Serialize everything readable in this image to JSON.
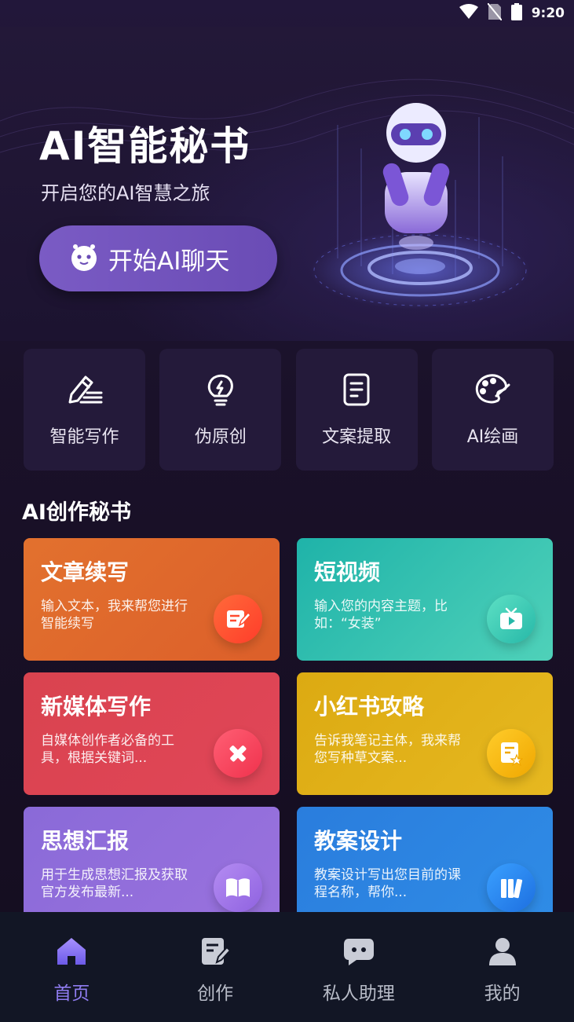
{
  "status_bar": {
    "time": "9:20"
  },
  "hero": {
    "title": "AI智能秘书",
    "subtitle": "开启您的AI智慧之旅",
    "start_button": "开始AI聊天"
  },
  "tools": [
    {
      "label": "智能写作",
      "icon": "pen-write-icon"
    },
    {
      "label": "伪原创",
      "icon": "lightbulb-icon"
    },
    {
      "label": "文案提取",
      "icon": "document-icon"
    },
    {
      "label": "AI绘画",
      "icon": "palette-icon"
    }
  ],
  "section_title": "AI创作秘书",
  "cards": [
    {
      "title": "文章续写",
      "desc": "输入文本，我来帮您进行智能续写",
      "icon": "edit-note-icon"
    },
    {
      "title": "短视频",
      "desc": "输入您的内容主题，比如：“女装”",
      "icon": "tv-play-icon"
    },
    {
      "title": "新媒体写作",
      "desc": "自媒体创作者必备的工具，根据关键词...",
      "icon": "pencil-ruler-icon"
    },
    {
      "title": "小红书攻略",
      "desc": "告诉我笔记主体，我来帮您写种草文案...",
      "icon": "note-star-icon"
    },
    {
      "title": "思想汇报",
      "desc": "用于生成思想汇报及获取官方发布最新...",
      "icon": "book-open-icon"
    },
    {
      "title": "教案设计",
      "desc": "教案设计写出您目前的课程名称，帮你...",
      "icon": "books-icon"
    }
  ],
  "colors": {
    "card_1": "#e26a2c",
    "card_2": "#3cc6b6",
    "card_3": "#dc4053",
    "card_4": "#e0b21c",
    "card_5": "#8a6ad8",
    "card_6": "#2d86e2",
    "active_nav": "#8f7cf0"
  },
  "nav": [
    {
      "label": "首页",
      "icon": "home-icon",
      "active": true
    },
    {
      "label": "创作",
      "icon": "create-icon"
    },
    {
      "label": "私人助理",
      "icon": "chat-bubble-icon"
    },
    {
      "label": "我的",
      "icon": "user-icon"
    }
  ]
}
